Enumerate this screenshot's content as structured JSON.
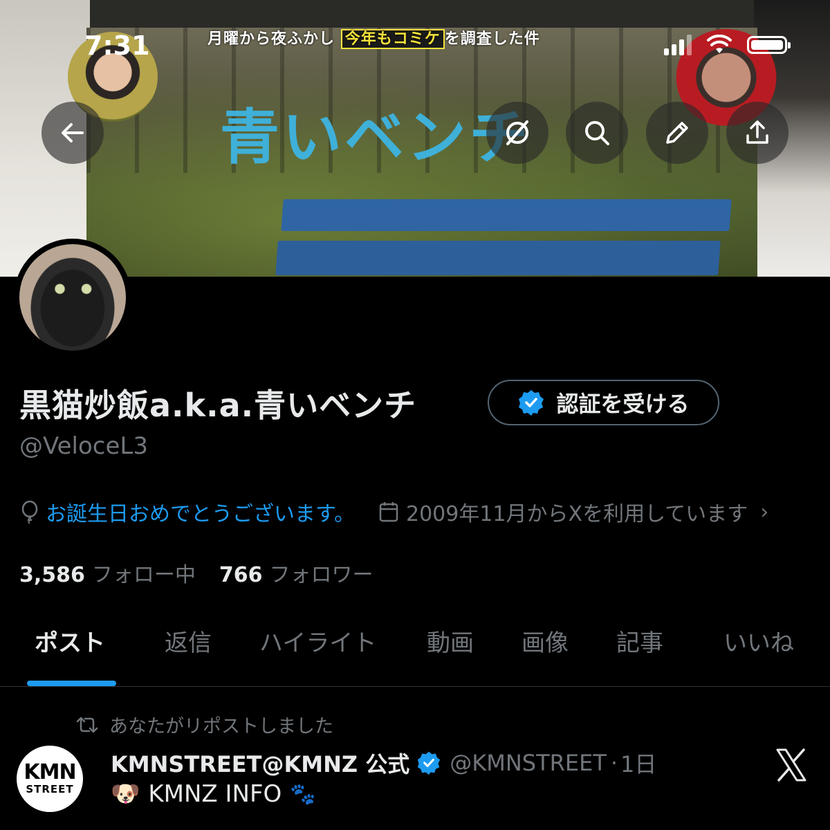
{
  "status_bar": {
    "time": "7:31"
  },
  "banner": {
    "tv_show_title": "月曜から夜ふかし",
    "tv_caption_highlight": "今年もコミケ",
    "tv_caption_rest": "を調査した件",
    "sign_text": "青いベンチ"
  },
  "profile": {
    "display_name": "黒猫炒飯a.k.a.青いベンチ",
    "verify_button_label": "認証を受ける",
    "handle": "@VeloceL3",
    "birthday_text": "お誕生日おめでとうございます。",
    "joined_text": "2009年11月からXを利用しています",
    "following_count": "3,586",
    "following_label": "フォロー中",
    "followers_count": "766",
    "followers_label": "フォロワー"
  },
  "tabs": [
    {
      "label": "ポスト",
      "active": true
    },
    {
      "label": "返信"
    },
    {
      "label": "ハイライト"
    },
    {
      "label": "動画"
    },
    {
      "label": "画像"
    },
    {
      "label": "記事"
    },
    {
      "label": "いいね"
    }
  ],
  "post": {
    "repost_label": "あなたがリポストしました",
    "author_name": "KMNSTREET@KMNZ 公式",
    "author_handle": "@KMNSTREET",
    "separator": "·",
    "time_ago": "1日",
    "text": "KMNZ INFO",
    "avatar_line1": "KMN",
    "avatar_line2": "STREET"
  },
  "colors": {
    "accent": "#1d9bf0",
    "secondary_text": "#71767b",
    "primary_text": "#e7e9ea",
    "background": "#000000"
  },
  "icons": {
    "back": "arrow-left-icon",
    "grok": "grok-icon",
    "search": "search-icon",
    "edit": "pencil-icon",
    "share": "share-icon",
    "verified": "verified-badge-icon",
    "birthday": "balloon-icon",
    "calendar": "calendar-icon",
    "repost": "repost-icon",
    "x_logo": "x-logo-icon"
  }
}
